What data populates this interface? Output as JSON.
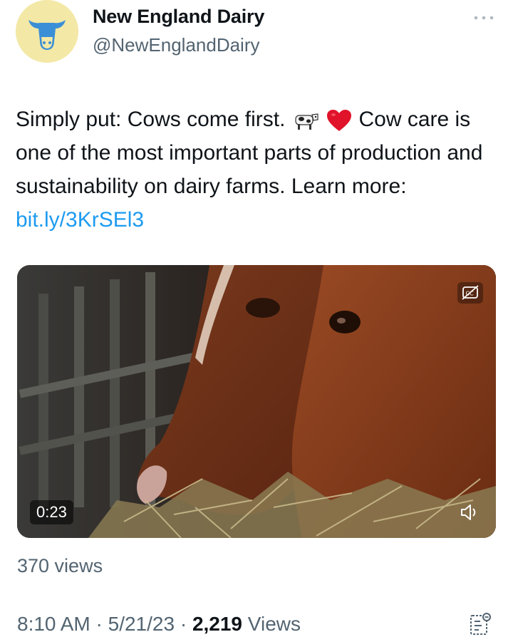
{
  "author": {
    "name": "New England Dairy",
    "handle": "@NewEnglandDairy",
    "avatar_icon": "cow-head-icon",
    "avatar_bg": "#f3e8a6",
    "avatar_fg": "#3b8fd6"
  },
  "more_icon": "more-horizontal-icon",
  "tweet": {
    "text_part1": "Simply put: Cows come first.",
    "emoji_1": "cow-emoji",
    "emoji_2": "red-heart-emoji",
    "text_part2": "Cow care is one of the most important parts of production and sustainability on dairy farms. Learn more:",
    "link": "bit.ly/3KrSEl3",
    "link_color": "#1d9bf0"
  },
  "media": {
    "duration": "0:23",
    "captions_icon": "closed-captions-icon",
    "volume_icon": "volume-icon",
    "views_label": "370 views"
  },
  "footer": {
    "time": "8:10 AM",
    "date": "5/21/23",
    "separator": "·",
    "view_count": "2,219",
    "views_word": "Views",
    "analytics_icon": "analytics-icon"
  }
}
